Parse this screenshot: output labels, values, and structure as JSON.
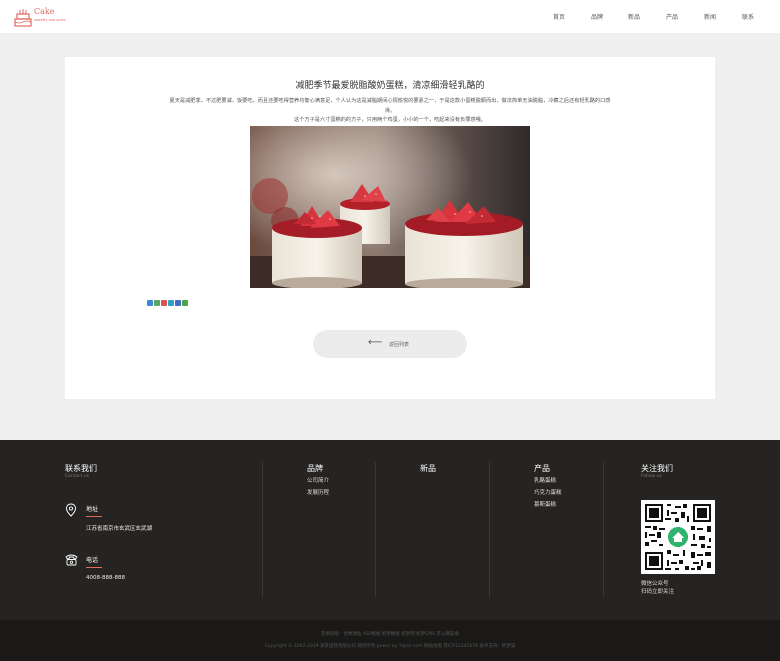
{
  "header": {
    "logo_text": "Cake",
    "logo_sub": "sweetly and quick",
    "nav": [
      "首页",
      "品牌",
      "新品",
      "产品",
      "新闻",
      "联系"
    ]
  },
  "article": {
    "title": "减肥季节最爱脱脂酸奶蛋糕，清凉细滑轻乳酪的",
    "paragraph1": "夏天是减肥季，不过肥要减，饭要吃，而且还要吃得营养均衡心满意足，个人认为这是减脂期间心情愉悦的要素之一，于是这款小蛋糕脱颖而出，做法简单无油脱脂，冷藏之后还有轻乳酪的口感",
    "paragraph1_tail": "滑。",
    "paragraph2": "这个方子是六寸蛋糕的的方子，只用两个鸡蛋，小小的一个，吃起来没有负罪感哦。",
    "back_label": "返回列表"
  },
  "share_icons": [
    "share-qzone-icon",
    "share-weibo-icon",
    "share-tqq-icon",
    "share-renren-icon",
    "share-kaixin-icon",
    "share-douban-icon"
  ],
  "footer": {
    "contact": {
      "title": "联系我们",
      "sub": "Contact us",
      "address_label": "地址",
      "address_value": "江苏省南京市玄武区玄武湖",
      "phone_label": "电话",
      "phone_value": "4008-888-888"
    },
    "brand": {
      "title": "品牌",
      "links": [
        "公司简介",
        "发展历程"
      ]
    },
    "newproducts": {
      "title": "新品"
    },
    "products": {
      "title": "产品",
      "links": [
        "乳酪蛋糕",
        "巧克力蛋糕",
        "慕斯蛋糕"
      ]
    },
    "follow": {
      "title": "关注我们",
      "sub": "Follow us",
      "caption1": "微信公众号",
      "caption2": "扫码立即关注"
    }
  },
  "bottom": {
    "line1": "友情链接：优秀建站 ASP模板 织梦模板 织梦网 织梦CMS 苏公网安备",
    "line2": "Copyright © 2002-2019 某某蛋糕有限公司 版权所有 power by Yzjzcl.com  网站地图  苏ICP12345678  技术支持：织梦猫"
  },
  "colors": {
    "accent": "#e2695f",
    "footer_bg": "#262422",
    "bottom_bg": "#1a1918"
  }
}
